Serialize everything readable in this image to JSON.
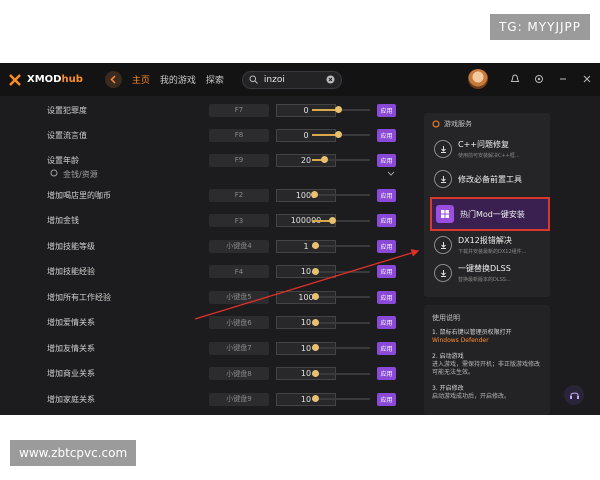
{
  "watermarks": {
    "top": "TG: MYYJJPP",
    "bottom": "www.zbtcpvc.com"
  },
  "header": {
    "logo_main": "XMOD",
    "logo_sub": "hub",
    "nav": [
      "主页",
      "我的游戏",
      "探索"
    ],
    "search_value": "inzoi"
  },
  "colors": {
    "accent": "#ff8c2a",
    "apply": "#8a49d6",
    "highlight_border": "#d8392b",
    "slider": "#d8a84a"
  },
  "rows": [
    {
      "label": "设置犯罪度",
      "hotkey": "F7",
      "value": "0",
      "slider": 0.45,
      "apply": "应用"
    },
    {
      "label": "设置流言值",
      "hotkey": "F8",
      "value": "0",
      "slider": 0.45,
      "apply": "应用"
    },
    {
      "label": "设置年龄",
      "hotkey": "F9",
      "value": "20",
      "slider": 0.2,
      "apply": "应用"
    },
    {
      "label": "增加喝店里的咖币",
      "hotkey": "F2",
      "value": "1000",
      "slider": 0.03,
      "apply": "应用"
    },
    {
      "label": "增加金钱",
      "hotkey": "F3",
      "value": "100000",
      "slider": 0.35,
      "apply": "应用"
    },
    {
      "label": "增加技能等级",
      "hotkey": "小键盘4",
      "value": "1",
      "slider": 0.05,
      "apply": "应用"
    },
    {
      "label": "增加技能经验",
      "hotkey": "F4",
      "value": "10",
      "slider": 0.05,
      "apply": "应用"
    },
    {
      "label": "增加所有工作经验",
      "hotkey": "小键盘5",
      "value": "100",
      "slider": 0.05,
      "apply": "应用"
    },
    {
      "label": "增加爱情关系",
      "hotkey": "小键盘6",
      "value": "10",
      "slider": 0.05,
      "apply": "应用"
    },
    {
      "label": "增加友情关系",
      "hotkey": "小键盘7",
      "value": "10",
      "slider": 0.05,
      "apply": "应用"
    },
    {
      "label": "增加商业关系",
      "hotkey": "小键盘8",
      "value": "10",
      "slider": 0.05,
      "apply": "应用"
    },
    {
      "label": "增加家庭关系",
      "hotkey": "小键盘9",
      "value": "10",
      "slider": 0.05,
      "apply": "应用"
    }
  ],
  "section": {
    "label": "金钱/资源"
  },
  "service": {
    "title": "游戏服务",
    "items": [
      {
        "name": "C++问题修复",
        "desc": "使用前可安装解决C++框...",
        "icon": "download-icon"
      },
      {
        "name": "修改必备前置工具",
        "desc": "",
        "icon": "download-icon"
      },
      {
        "name": "热门Mod一键安装",
        "desc": "",
        "icon": "mod-icon"
      },
      {
        "name": "DX12报错解决",
        "desc": "下载并安装最新的DX12组件...",
        "icon": "download-icon"
      },
      {
        "name": "一键替换DLSS",
        "desc": "替换最新版本的DLSS...",
        "icon": "download-icon"
      }
    ]
  },
  "help": {
    "title": "使用说明",
    "items": [
      {
        "n": "1. 鼠标右键以管理员权限打开",
        "t": "",
        "orange": "Windows Defender"
      },
      {
        "n": "2. 启动游戏",
        "t": "进入游戏，需保持开机；非正版游戏修改可能无法生效。"
      },
      {
        "n": "3. 开启修改",
        "t": "启动游戏成功后，开启修改。"
      }
    ]
  }
}
